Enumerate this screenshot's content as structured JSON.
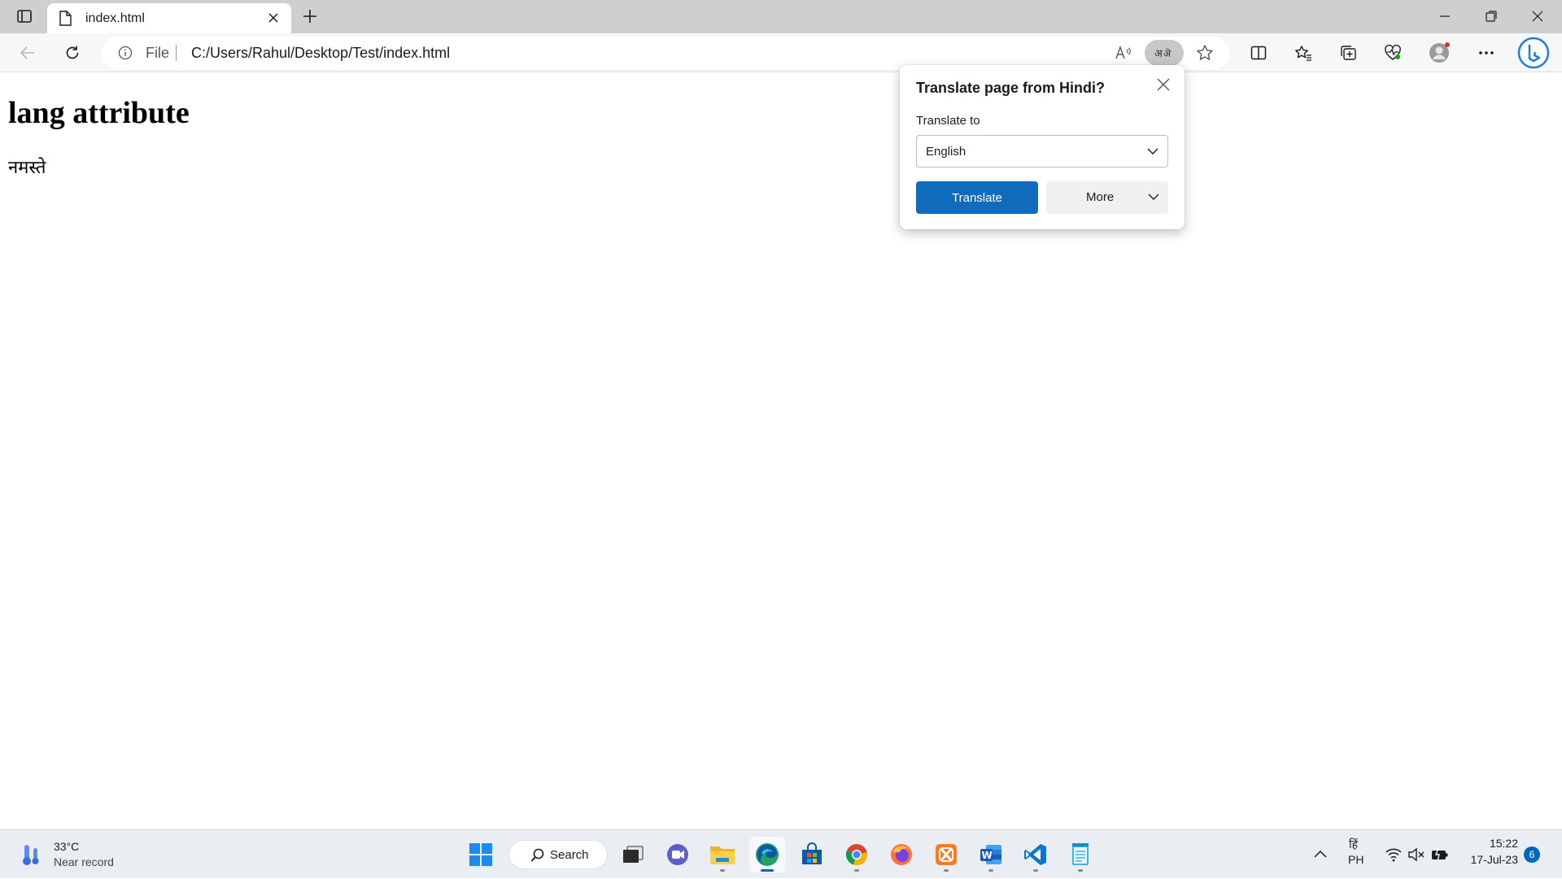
{
  "browser": {
    "tab": {
      "title": "index.html"
    },
    "address_bar": {
      "scheme_label": "File",
      "url": "C:/Users/Rahul/Desktop/Test/index.html"
    }
  },
  "page": {
    "heading": "lang attribute",
    "text": "नमस्ते"
  },
  "translate_popup": {
    "title": "Translate page from Hindi?",
    "translate_to_label": "Translate to",
    "selected_language": "English",
    "translate_button": "Translate",
    "more_button": "More"
  },
  "taskbar": {
    "weather": {
      "temperature": "33°C",
      "description": "Near record"
    },
    "search_label": "Search",
    "apps": [
      "start-icon",
      "task-view-icon",
      "teams-chat-icon",
      "file-explorer-icon",
      "edge-icon",
      "store-icon",
      "chrome-icon",
      "firefox-icon",
      "xampp-icon",
      "word-icon",
      "vscode-icon",
      "notepad-icon"
    ],
    "tray": {
      "input_script": "हिं",
      "input_locale": "PH",
      "time": "15:22",
      "date": "17-Jul-23",
      "notification_count": "6"
    }
  },
  "colors": {
    "accent": "#0f6cbd",
    "tabstrip": "#cfcfcf",
    "taskbar": "#eaeef3"
  }
}
